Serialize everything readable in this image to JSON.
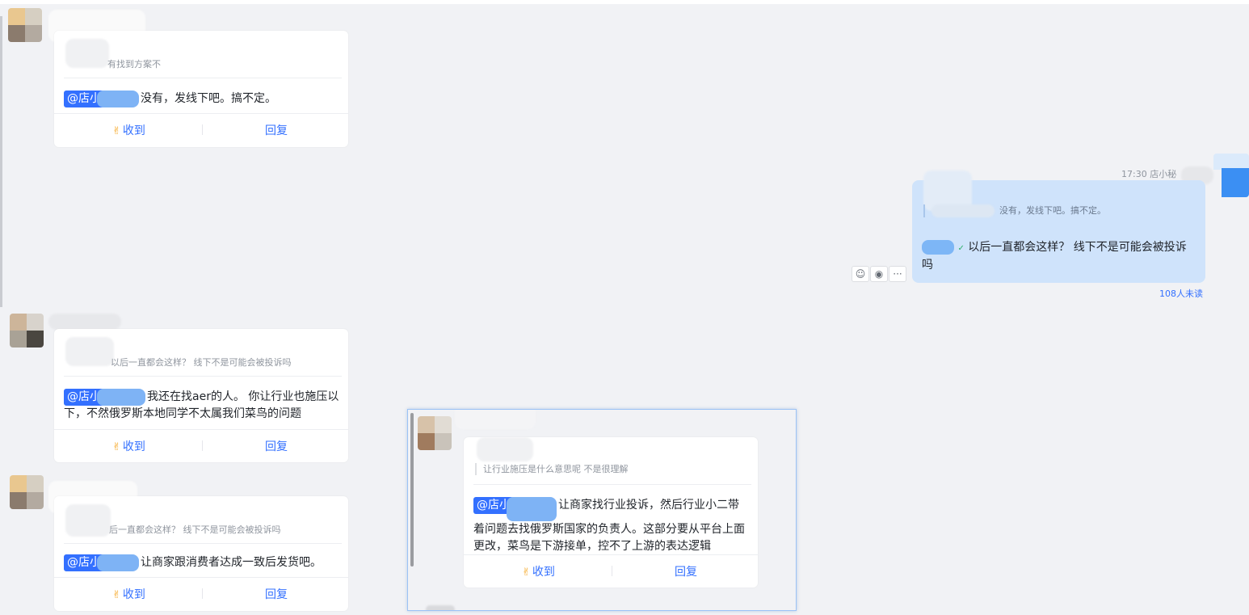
{
  "cards": [
    {
      "quote": "有找到方案不",
      "mention": "@店小",
      "text": "没有，发线下吧。搞不定。",
      "ack": "收到",
      "reply": "回复"
    },
    {
      "quote": "以后一直都会这样？ 线下不是可能会被投诉吗",
      "mention": "@店小",
      "text1": "我还在找aer的人。 你让行业也施压以",
      "text2": "下，不然俄罗斯本地同学不太属我们菜鸟的问题",
      "ack": "收到",
      "reply": "回复"
    },
    {
      "quote": "后一直都会这样？ 线下不是可能会被投诉吗",
      "mention": "@店小",
      "text": "让商家跟消费者达成一致后发货吧。",
      "ack": "收到",
      "reply": "回复"
    }
  ],
  "self_message": {
    "time": "17:30",
    "sender": "店小秘",
    "quote": "没有，发线下吧。搞不定。",
    "text1": "以后一直都会这样？ 线下不是可能会被投诉",
    "text2": "吗",
    "unread": "108人未读",
    "more_icon": "···"
  },
  "popup": {
    "quote": "让行业施压是什么意思呢 不是很理解",
    "mention": "@店小",
    "text1": "让商家找行业投诉，然后行业小二带",
    "text2": "着问题去找俄罗斯国家的负责人。这部分要从平台上面",
    "text3": "更改，菜鸟是下游接单，控不了上游的表达逻辑",
    "ack": "收到",
    "reply": "回复"
  },
  "colors": {
    "background": "#f1f2f5",
    "accent": "#3370ff",
    "bubble": "#cfe3fb"
  }
}
